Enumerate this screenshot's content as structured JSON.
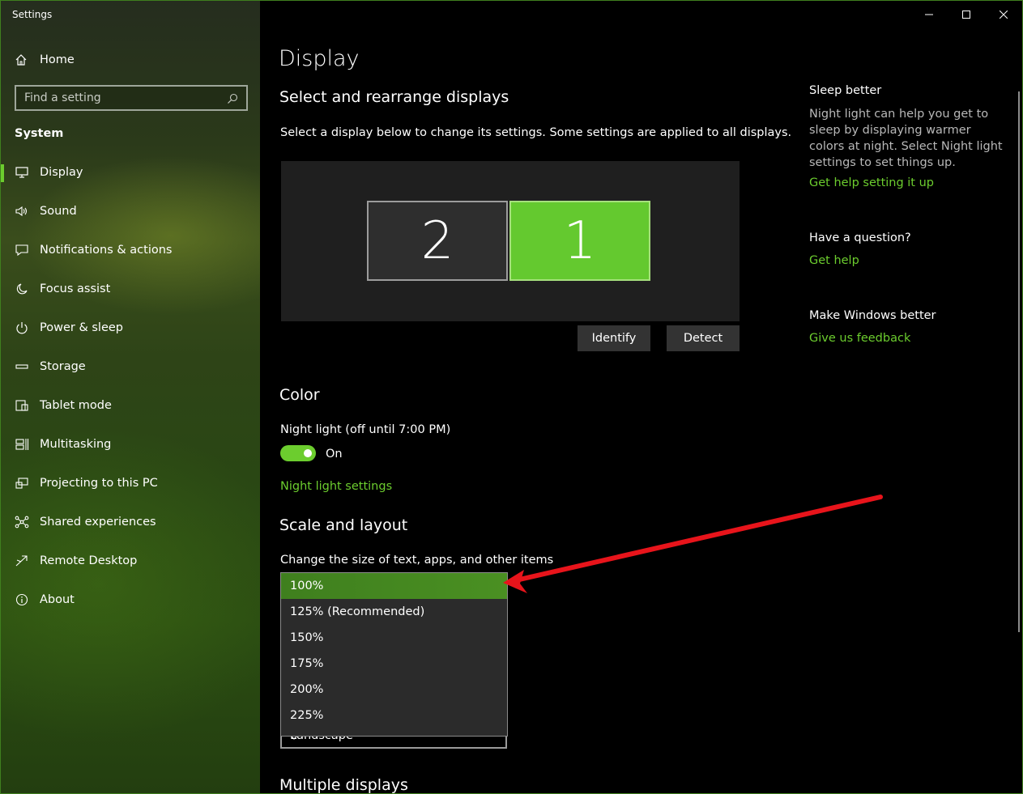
{
  "window": {
    "app_title": "Settings"
  },
  "sidebar": {
    "home_label": "Home",
    "search_placeholder": "Find a setting",
    "section_label": "System",
    "items": [
      {
        "label": "Display",
        "icon": "monitor-icon",
        "active": true
      },
      {
        "label": "Sound",
        "icon": "speaker-icon"
      },
      {
        "label": "Notifications & actions",
        "icon": "notification-icon"
      },
      {
        "label": "Focus assist",
        "icon": "moon-icon"
      },
      {
        "label": "Power & sleep",
        "icon": "power-icon"
      },
      {
        "label": "Storage",
        "icon": "storage-icon"
      },
      {
        "label": "Tablet mode",
        "icon": "tablet-icon"
      },
      {
        "label": "Multitasking",
        "icon": "multitasking-icon"
      },
      {
        "label": "Projecting to this PC",
        "icon": "projecting-icon"
      },
      {
        "label": "Shared experiences",
        "icon": "shared-icon"
      },
      {
        "label": "Remote Desktop",
        "icon": "remote-desktop-icon"
      },
      {
        "label": "About",
        "icon": "info-icon"
      }
    ]
  },
  "main": {
    "title": "Display",
    "rearrange": {
      "heading": "Select and rearrange displays",
      "description": "Select a display below to change its settings. Some settings are applied to all displays.",
      "monitors": [
        "2",
        "1"
      ],
      "identify_label": "Identify",
      "detect_label": "Detect"
    },
    "color": {
      "heading": "Color",
      "night_light_label": "Night light (off until 7:00 PM)",
      "toggle_state": "On",
      "night_light_link": "Night light settings"
    },
    "scale": {
      "heading": "Scale and layout",
      "description": "Change the size of text, apps, and other items",
      "options": [
        "100%",
        "125% (Recommended)",
        "150%",
        "175%",
        "200%",
        "225%"
      ],
      "selected": "100%",
      "orientation_value": "Landscape"
    },
    "multiple_displays_heading": "Multiple displays"
  },
  "right": {
    "sleep_heading": "Sleep better",
    "sleep_text": "Night light can help you get to sleep by displaying warmer colors at night. Select Night light settings to set things up.",
    "sleep_link": "Get help setting it up",
    "question_heading": "Have a question?",
    "question_link": "Get help",
    "feedback_heading": "Make Windows better",
    "feedback_link": "Give us feedback"
  },
  "colors": {
    "accent": "#6ccd2e",
    "annotation_arrow": "#e8141b"
  }
}
